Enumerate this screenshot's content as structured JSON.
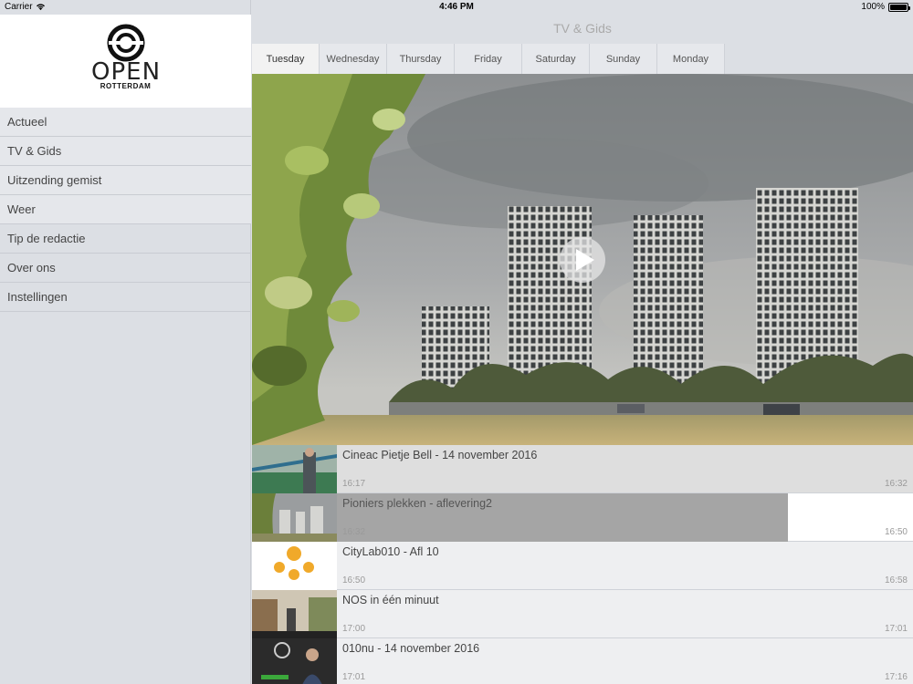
{
  "status": {
    "carrier": "Carrier",
    "time": "4:46 PM",
    "battery": "100%"
  },
  "sidebar": {
    "logo": {
      "word": "OPEN",
      "city": "ROTTERDAM"
    },
    "items": [
      {
        "label": "Actueel"
      },
      {
        "label": "TV & Gids"
      },
      {
        "label": "Uitzending gemist"
      },
      {
        "label": "Weer"
      },
      {
        "label": "Tip de redactie"
      },
      {
        "label": "Over ons"
      },
      {
        "label": "Instellingen"
      }
    ]
  },
  "header": {
    "title": "TV & Gids"
  },
  "days": [
    "Tuesday",
    "Wednesday",
    "Thursday",
    "Friday",
    "Saturday",
    "Sunday",
    "Monday"
  ],
  "player": {
    "icon": "play-icon"
  },
  "programmes": [
    {
      "title": "Cineac Pietje Bell - 14 november 2016",
      "start": "16:17",
      "end": "16:32"
    },
    {
      "title": "Pioniers plekken - aflevering2",
      "start": "16:32",
      "end": "16:50"
    },
    {
      "title": "CityLab010 - Afl 10",
      "start": "16:50",
      "end": "16:58"
    },
    {
      "title": "NOS in één minuut",
      "start": "17:00",
      "end": "17:01"
    },
    {
      "title": "010nu - 14 november 2016",
      "start": "17:01",
      "end": "17:16"
    }
  ],
  "colors": {
    "sidebar": "#dcdfe4",
    "highlight": "#a5a5a5"
  }
}
